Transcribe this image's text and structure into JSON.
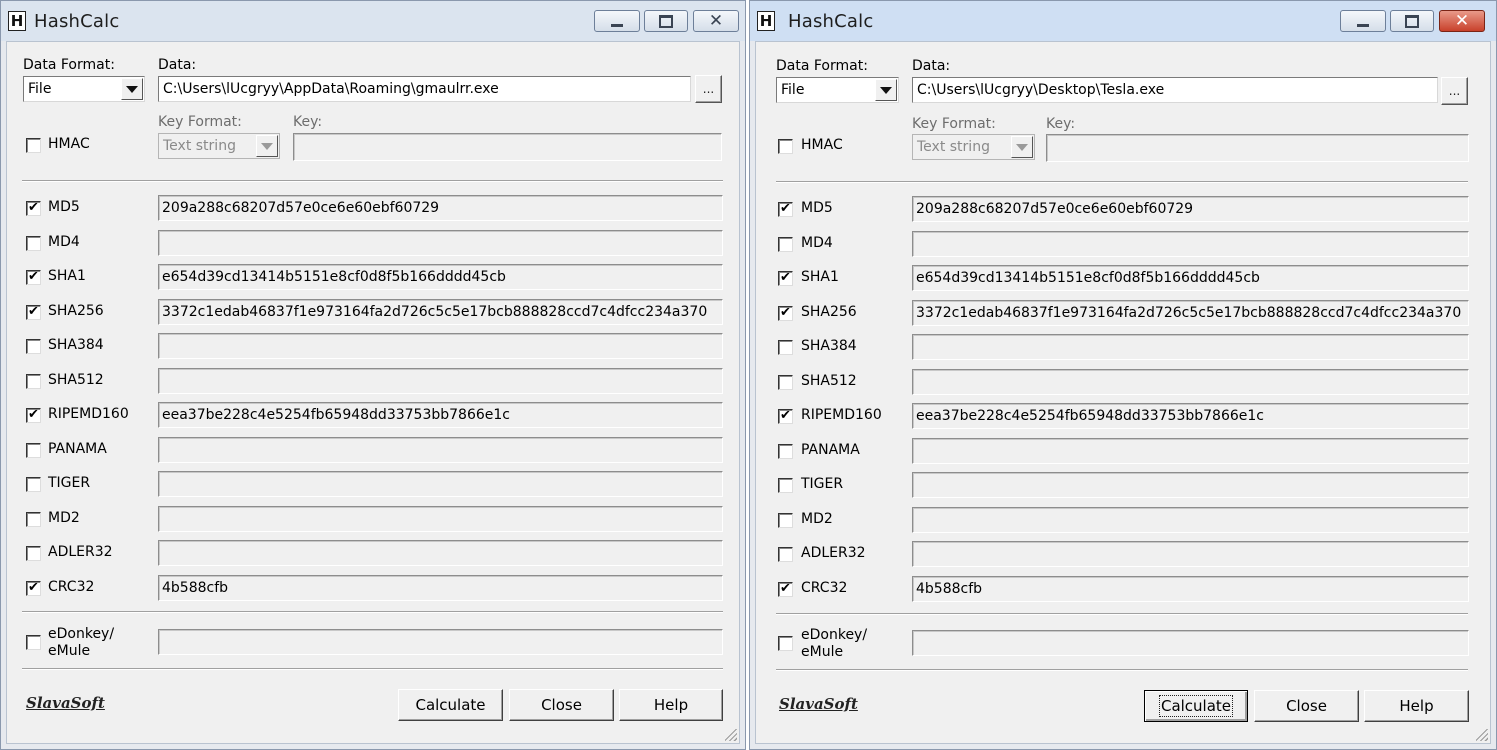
{
  "windows": [
    {
      "title": "HashCalc",
      "data_format_label": "Data Format:",
      "data_format_value": "File",
      "data_label": "Data:",
      "data_value": "C:\\Users\\lUcgryy\\AppData\\Roaming\\gmaulrr.exe",
      "browse_label": "...",
      "hmac_label": "HMAC",
      "key_format_label": "Key Format:",
      "key_format_value": "Text string",
      "key_label": "Key:",
      "hashes": [
        {
          "name": "MD5",
          "checked": true,
          "value": "209a288c68207d57e0ce6e60ebf60729"
        },
        {
          "name": "MD4",
          "checked": false,
          "value": ""
        },
        {
          "name": "SHA1",
          "checked": true,
          "value": "e654d39cd13414b5151e8cf0d8f5b166dddd45cb"
        },
        {
          "name": "SHA256",
          "checked": true,
          "value": "3372c1edab46837f1e973164fa2d726c5c5e17bcb888828ccd7c4dfcc234a370"
        },
        {
          "name": "SHA384",
          "checked": false,
          "value": ""
        },
        {
          "name": "SHA512",
          "checked": false,
          "value": ""
        },
        {
          "name": "RIPEMD160",
          "checked": true,
          "value": "eea37be228c4e5254fb65948dd33753bb7866e1c"
        },
        {
          "name": "PANAMA",
          "checked": false,
          "value": ""
        },
        {
          "name": "TIGER",
          "checked": false,
          "value": ""
        },
        {
          "name": "MD2",
          "checked": false,
          "value": ""
        },
        {
          "name": "ADLER32",
          "checked": false,
          "value": ""
        },
        {
          "name": "CRC32",
          "checked": true,
          "value": "4b588cfb"
        }
      ],
      "edonkey_line1": "eDonkey/",
      "edonkey_line2": "eMule",
      "edonkey_checked": false,
      "edonkey_value": "",
      "brand": "SlavaSoft",
      "calculate_label": "Calculate",
      "close_label": "Close",
      "help_label": "Help"
    },
    {
      "title": "HashCalc",
      "data_format_label": "Data Format:",
      "data_format_value": "File",
      "data_label": "Data:",
      "data_value": "C:\\Users\\lUcgryy\\Desktop\\Tesla.exe",
      "browse_label": "...",
      "hmac_label": "HMAC",
      "key_format_label": "Key Format:",
      "key_format_value": "Text string",
      "key_label": "Key:",
      "hashes": [
        {
          "name": "MD5",
          "checked": true,
          "value": "209a288c68207d57e0ce6e60ebf60729"
        },
        {
          "name": "MD4",
          "checked": false,
          "value": ""
        },
        {
          "name": "SHA1",
          "checked": true,
          "value": "e654d39cd13414b5151e8cf0d8f5b166dddd45cb"
        },
        {
          "name": "SHA256",
          "checked": true,
          "value": "3372c1edab46837f1e973164fa2d726c5c5e17bcb888828ccd7c4dfcc234a370"
        },
        {
          "name": "SHA384",
          "checked": false,
          "value": ""
        },
        {
          "name": "SHA512",
          "checked": false,
          "value": ""
        },
        {
          "name": "RIPEMD160",
          "checked": true,
          "value": "eea37be228c4e5254fb65948dd33753bb7866e1c"
        },
        {
          "name": "PANAMA",
          "checked": false,
          "value": ""
        },
        {
          "name": "TIGER",
          "checked": false,
          "value": ""
        },
        {
          "name": "MD2",
          "checked": false,
          "value": ""
        },
        {
          "name": "ADLER32",
          "checked": false,
          "value": ""
        },
        {
          "name": "CRC32",
          "checked": true,
          "value": "4b588cfb"
        }
      ],
      "edonkey_line1": "eDonkey/",
      "edonkey_line2": "eMule",
      "edonkey_checked": false,
      "edonkey_value": "",
      "brand": "SlavaSoft",
      "calculate_label": "Calculate",
      "close_label": "Close",
      "help_label": "Help"
    }
  ],
  "icons": {
    "app": "H",
    "minimize": "minimize-icon",
    "maximize": "maximize-icon",
    "close": "close-icon",
    "checkmark": "✔",
    "dropdown": "chevron-down-icon"
  },
  "colors": {
    "titlebar_inactive": "#dbe4ef",
    "titlebar_active": "#cfdff3",
    "close_active": "#c8412b",
    "dialog_face": "#f0f0f0"
  }
}
